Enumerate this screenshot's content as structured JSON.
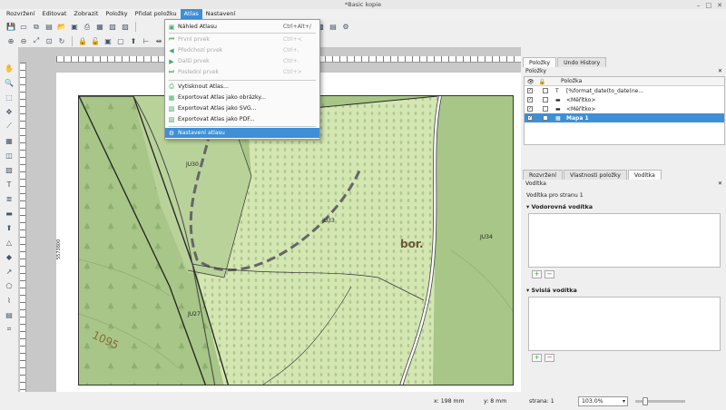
{
  "window": {
    "title": "*Basic kopie"
  },
  "menubar": [
    "Rozvržení",
    "Editovat",
    "Zobrazit",
    "Položky",
    "Přidat položku",
    "Atlas",
    "Nastavení"
  ],
  "atlas_menu": {
    "items": [
      {
        "label": "Náhled Atlasu",
        "shortcut": "Ctrl+Alt+/",
        "enabled": true
      },
      {
        "label": "První prvek",
        "shortcut": "Ctrl+<",
        "enabled": false
      },
      {
        "label": "Předchozí prvek",
        "shortcut": "Ctrl+,",
        "enabled": false
      },
      {
        "label": "Další prvek",
        "shortcut": "Ctrl+.",
        "enabled": false
      },
      {
        "label": "Poslední prvek",
        "shortcut": "Ctrl+>",
        "enabled": false
      },
      {
        "label": "Vytisknout Atlas...",
        "shortcut": "",
        "enabled": true
      },
      {
        "label": "Exportovat Atlas jako obrázky...",
        "shortcut": "",
        "enabled": true
      },
      {
        "label": "Exportovat Atlas jako SVG...",
        "shortcut": "",
        "enabled": true
      },
      {
        "label": "Exportovat Atlas jako PDF...",
        "shortcut": "",
        "enabled": true
      },
      {
        "label": "Nastavení atlasu",
        "shortcut": "",
        "enabled": true
      }
    ]
  },
  "map": {
    "labels": [
      "JU30",
      "JU33",
      "JU34",
      "JU27",
      "bor.",
      "1095",
      "5573800"
    ]
  },
  "panel": {
    "tabs": [
      "Položky",
      "Undo History"
    ],
    "items_title": "Položky",
    "items_header": "Položka",
    "items": [
      {
        "name": "[%format_date(to_date(ne...",
        "visible": true,
        "locked": false
      },
      {
        "name": "<Měřítko>",
        "visible": true,
        "locked": false
      },
      {
        "name": "<Měřítko>",
        "visible": true,
        "locked": false
      },
      {
        "name": "Mapa 1",
        "visible": true,
        "locked": false
      }
    ],
    "lower_tabs": [
      "Rozvržení",
      "Vlastnosti položky",
      "Vodítka"
    ],
    "guides_title": "Vodítka",
    "guides_page": "Vodítka pro stranu 1",
    "horizontal": "Vodorovná vodítka",
    "vertical": "Svislá vodítka"
  },
  "status": {
    "x": "x: 198 mm",
    "y": "y: 8 mm",
    "page": "strana: 1",
    "zoom": "103.0%"
  }
}
